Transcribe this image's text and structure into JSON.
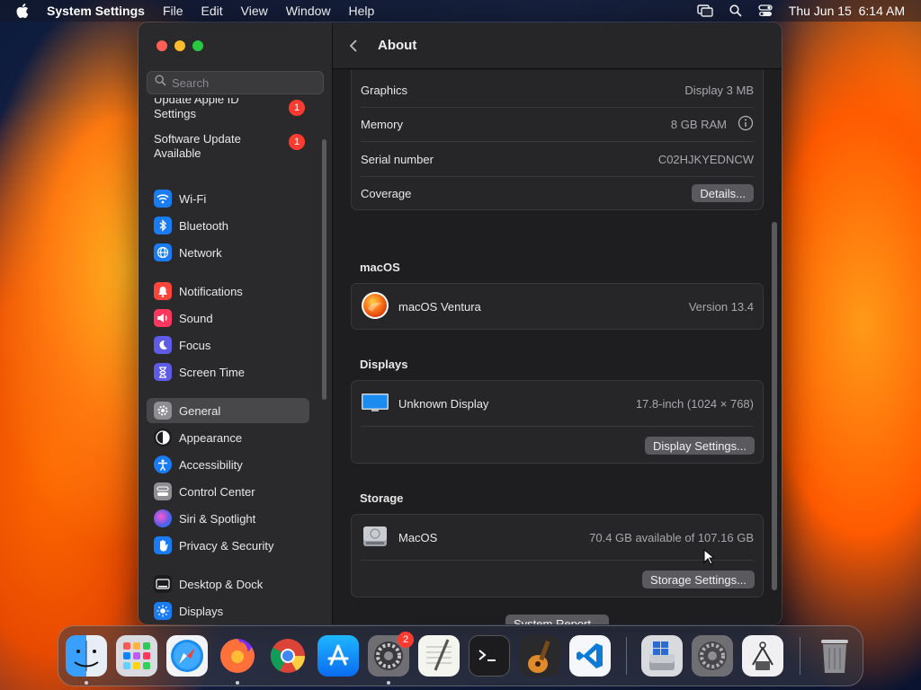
{
  "menubar": {
    "app_name": "System Settings",
    "menus": [
      "File",
      "Edit",
      "View",
      "Window",
      "Help"
    ],
    "clock": "Thu Jun 15  6:14 AM"
  },
  "sidebar": {
    "search_placeholder": "Search",
    "updates": [
      {
        "label": "Update Apple ID Settings",
        "badge": "1"
      },
      {
        "label": "Software Update Available",
        "badge": "1"
      }
    ],
    "items": [
      {
        "label": "Wi-Fi",
        "icon": "wifi-icon",
        "color": "#1a7cf5"
      },
      {
        "label": "Bluetooth",
        "icon": "bluetooth-icon",
        "color": "#1a7cf5"
      },
      {
        "label": "Network",
        "icon": "globe-icon",
        "color": "#1a7cf5"
      },
      {
        "label": "Notifications",
        "icon": "bell-icon",
        "color": "#ff453a"
      },
      {
        "label": "Sound",
        "icon": "speaker-icon",
        "color": "#ff375f"
      },
      {
        "label": "Focus",
        "icon": "moon-icon",
        "color": "#5e5ce6"
      },
      {
        "label": "Screen Time",
        "icon": "hourglass-icon",
        "color": "#5e5ce6"
      },
      {
        "label": "General",
        "icon": "gear-icon",
        "color": "#8e8e93",
        "selected": true
      },
      {
        "label": "Appearance",
        "icon": "appearance-icon",
        "color": "#1c1c1e"
      },
      {
        "label": "Accessibility",
        "icon": "accessibility-icon",
        "color": "#1a7cf5"
      },
      {
        "label": "Control Center",
        "icon": "control-center-icon",
        "color": "#8e8e93"
      },
      {
        "label": "Siri & Spotlight",
        "icon": "siri-icon",
        "color": "#bf5af2"
      },
      {
        "label": "Privacy & Security",
        "icon": "hand-icon",
        "color": "#1a7cf5"
      },
      {
        "label": "Desktop & Dock",
        "icon": "dock-icon",
        "color": "#1c1c1e"
      },
      {
        "label": "Displays",
        "icon": "sun-icon",
        "color": "#1a7cf5"
      }
    ]
  },
  "main": {
    "title": "About",
    "specs": [
      {
        "label": "Graphics",
        "value": "Display 3 MB"
      },
      {
        "label": "Memory",
        "value": "8 GB RAM"
      },
      {
        "label": "Serial number",
        "value": "C02HJKYEDNCW"
      },
      {
        "label": "Coverage",
        "button": "Details..."
      }
    ],
    "macos": {
      "section": "macOS",
      "name": "macOS Ventura",
      "version": "Version 13.4"
    },
    "displays": {
      "section": "Displays",
      "name": "Unknown Display",
      "spec": "17.8-inch (1024 × 768)",
      "button": "Display Settings..."
    },
    "storage": {
      "section": "Storage",
      "name": "MacOS",
      "spec": "70.4 GB available of 107.16 GB",
      "button": "Storage Settings..."
    },
    "system_report_button": "System Report..."
  },
  "dock": {
    "apps": [
      "Finder",
      "Launchpad",
      "Safari",
      "Firefox",
      "Chrome",
      "App Store",
      "System Settings",
      "TextEdit",
      "Terminal",
      "GarageBand",
      "Visual Studio Code",
      "Boot Camp Assistant",
      "System Preferences",
      "Printer Utility",
      "Trash"
    ],
    "settings_badge": "2"
  }
}
